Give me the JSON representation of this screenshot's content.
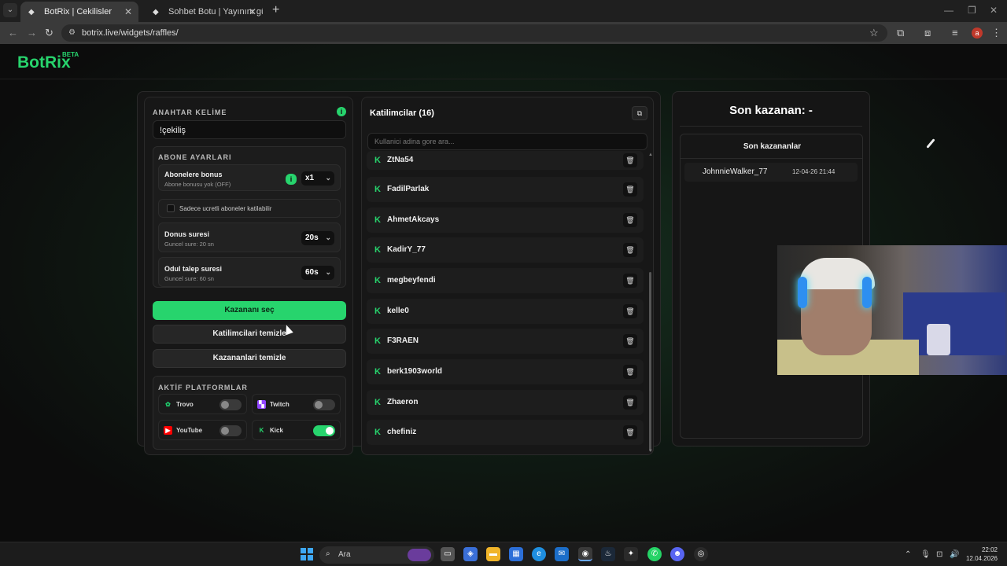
{
  "browser": {
    "tabs": [
      {
        "title": "BotRix | Cekilisler",
        "active": true
      },
      {
        "title": "Sohbet Botu | Yayınını güçlendir",
        "active": false
      }
    ],
    "url": "botrix.live/widgets/raffles/"
  },
  "app": {
    "logo": "BotRix",
    "badge": "BETA"
  },
  "settings": {
    "keyword_title": "ANAHTAR KELİME",
    "keyword_value": "!çekiliş",
    "sub_title": "ABONE AYARLARI",
    "bonus_label": "Abonelere bonus",
    "bonus_sub": "Abone bonusu yok (OFF)",
    "bonus_value": "x1",
    "paid_only_label": "Sadece ucretli aboneler katilabilir",
    "bonus_time_label": "Donus suresi",
    "bonus_time_sub": "Guncel sure: 20 sn",
    "bonus_time_value": "20s",
    "claim_label": "Odul talep suresi",
    "claim_sub": "Guncel sure: 60 sn",
    "claim_value": "60s",
    "pick_winner": "Kazananı seç",
    "clear_participants": "Katilimcilari temizle",
    "clear_winners": "Kazananlari temizle",
    "platforms_title": "AKTİF PLATFORMLAR",
    "platforms": [
      {
        "name": "Trovo",
        "on": false,
        "color": "#1fd26f"
      },
      {
        "name": "Twitch",
        "on": false,
        "color": "#9146ff"
      },
      {
        "name": "YouTube",
        "on": false,
        "color": "#ff0000"
      },
      {
        "name": "Kick",
        "on": true,
        "color": "#27d46d"
      }
    ]
  },
  "participants": {
    "title": "Katilimcilar (16)",
    "search_placeholder": "Kullanici adina gore ara...",
    "items": [
      "ZtNa54",
      "FadilParlak",
      "AhmetAkcays",
      "KadirY_77",
      "megbeyfendi",
      "kelle0",
      "F3RAEN",
      "berk1903world",
      "Zhaeron",
      "chefiniz"
    ]
  },
  "winners": {
    "title": "Son kazanan: -",
    "list_title": "Son kazananlar",
    "items": [
      {
        "name": "JohnnieWalker_77",
        "time": "12-04-26 21:44"
      }
    ]
  },
  "taskbar": {
    "search": "Ara",
    "time": "22:02",
    "date": "12.04.2026"
  }
}
